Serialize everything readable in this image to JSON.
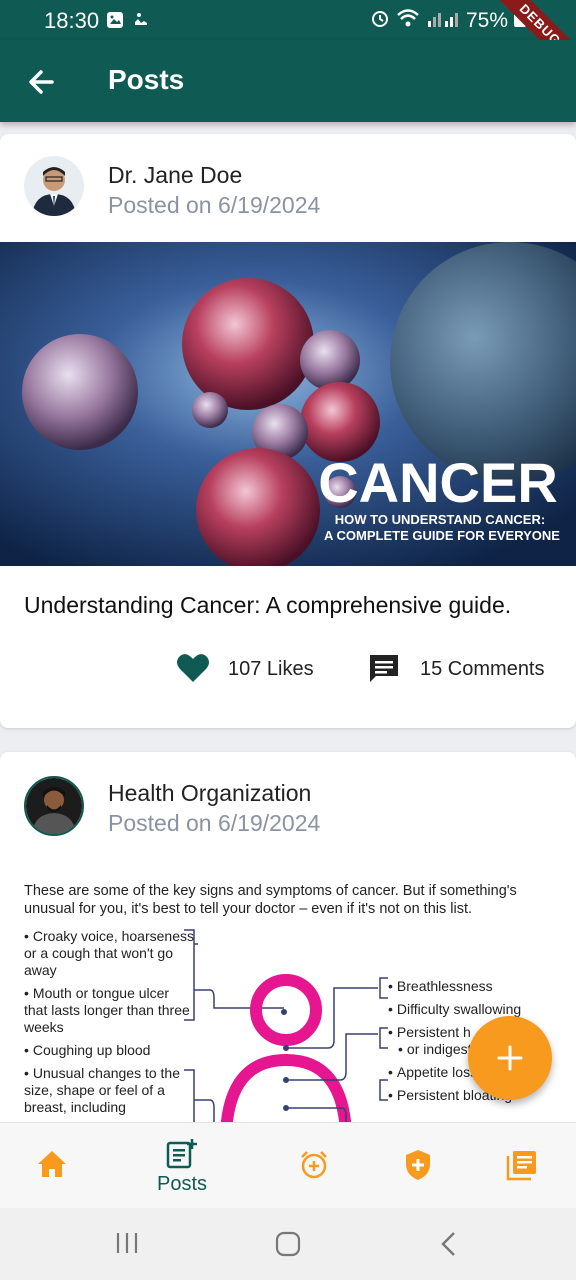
{
  "status_bar": {
    "time": "18:30",
    "battery": "75%",
    "debug_label": "DEBUG"
  },
  "app_bar": {
    "title": "Posts"
  },
  "posts": [
    {
      "author": "Dr. Jane Doe",
      "posted": "Posted on 6/19/2024",
      "image_title": "CANCER",
      "image_subtitle_1": "HOW TO UNDERSTAND CANCER:",
      "image_subtitle_2": "A COMPLETE GUIDE FOR EVERYONE",
      "caption": "Understanding Cancer: A comprehensive guide.",
      "likes": "107 Likes",
      "comments": "15 Comments"
    },
    {
      "author": "Health Organization",
      "posted": "Posted on 6/19/2024",
      "intro": "These are some of the key signs and symptoms of cancer. But if something's unusual for you, it's best to tell your doctor – even if it's not on this list.",
      "left_items": [
        "Croaky voice, hoarseness or a cough that won't go away",
        "Mouth or tongue ulcer that lasts longer than three weeks",
        "Coughing up blood",
        "Unusual changes to the size, shape or feel of a breast, including"
      ],
      "right_items": [
        "Breathlessness",
        "Difficulty swallowing",
        "Persistent h",
        "or indigest",
        "Appetite loss",
        "Persistent bloating"
      ]
    }
  ],
  "bottom_nav": {
    "posts_label": "Posts"
  },
  "colors": {
    "primary": "#0f5a52",
    "accent": "#f79a1e"
  }
}
